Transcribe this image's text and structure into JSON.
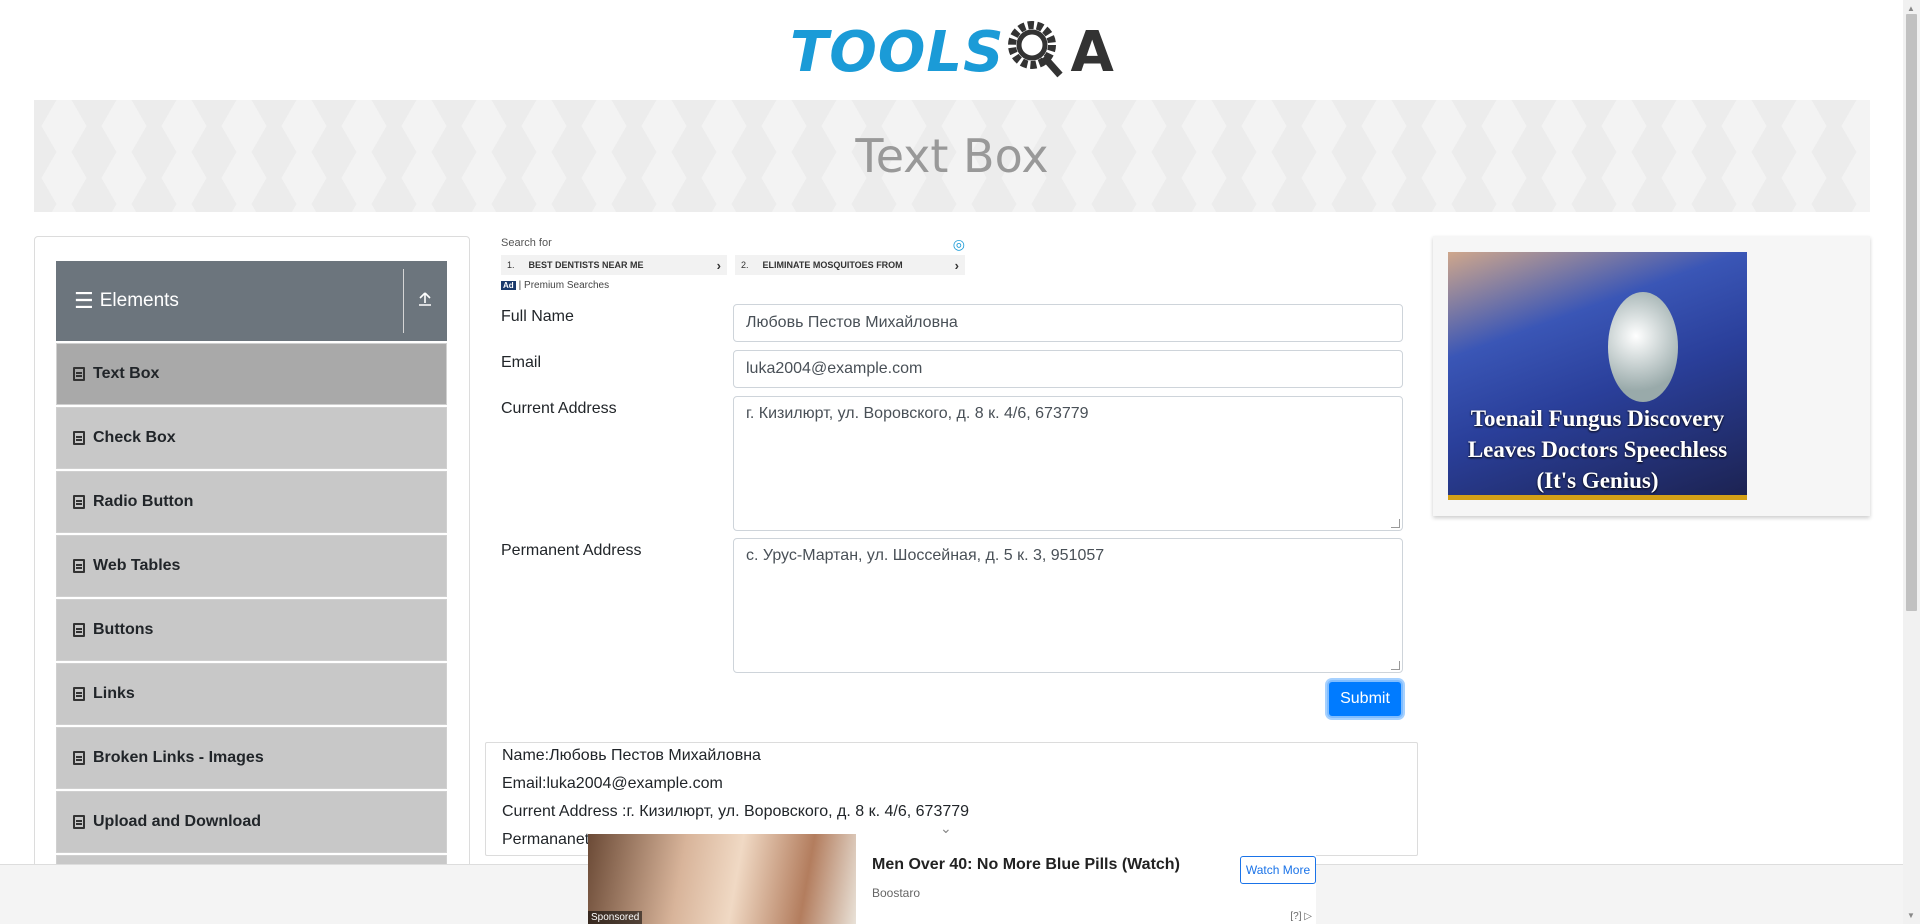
{
  "header": {
    "logo_tools": "TOOLS",
    "logo_qa": "QA",
    "page_title": "Text Box"
  },
  "sidebar": {
    "group_title": "Elements",
    "items": [
      {
        "label": "Text Box",
        "active": true
      },
      {
        "label": "Check Box"
      },
      {
        "label": "Radio Button"
      },
      {
        "label": "Web Tables"
      },
      {
        "label": "Buttons"
      },
      {
        "label": "Links"
      },
      {
        "label": "Broken Links - Images"
      },
      {
        "label": "Upload and Download"
      }
    ]
  },
  "search_ads": {
    "search_for": "Search for",
    "items": [
      {
        "num": "1.",
        "label": "BEST DENTISTS NEAR ME"
      },
      {
        "num": "2.",
        "label": "ELIMINATE MOSQUITOES FROM"
      }
    ],
    "ad_badge": "Ad",
    "ad_source": "| Premium Searches"
  },
  "form": {
    "full_name_label": "Full Name",
    "full_name_value": "Любовь Пестов Михайловна",
    "email_label": "Email",
    "email_value": "luka2004@example.com",
    "current_address_label": "Current Address",
    "current_address_value": "г. Кизилюрт, ул. Воровского, д. 8 к. 4/6, 673779",
    "permanent_address_label": "Permanent Address",
    "permanent_address_value": "с. Урус-Мартан, ул. Шоссейная, д. 5 к. 3, 951057",
    "submit_label": "Submit"
  },
  "output": {
    "name": "Name:Любовь Пестов Михайловна",
    "email": "Email:luka2004@example.com",
    "current_address": "Current Address :г. Кизилюрт, ул. Воровского, д. 8 к. 4/6, 673779",
    "permanent_address": "Permananet"
  },
  "right_ad": {
    "caption": "Toenail Fungus Discovery Leaves Doctors Speechless (It's Genius)"
  },
  "bottom_ad": {
    "sponsored": "Sponsored",
    "headline": "Men Over 40: No More Blue Pills (Watch)",
    "brand": "Boostaro",
    "button": "Watch More",
    "info": "[?]"
  },
  "colors": {
    "brand_blue": "#1b9bd7",
    "sidebar_header": "#6c757d",
    "submit": "#007bff"
  }
}
